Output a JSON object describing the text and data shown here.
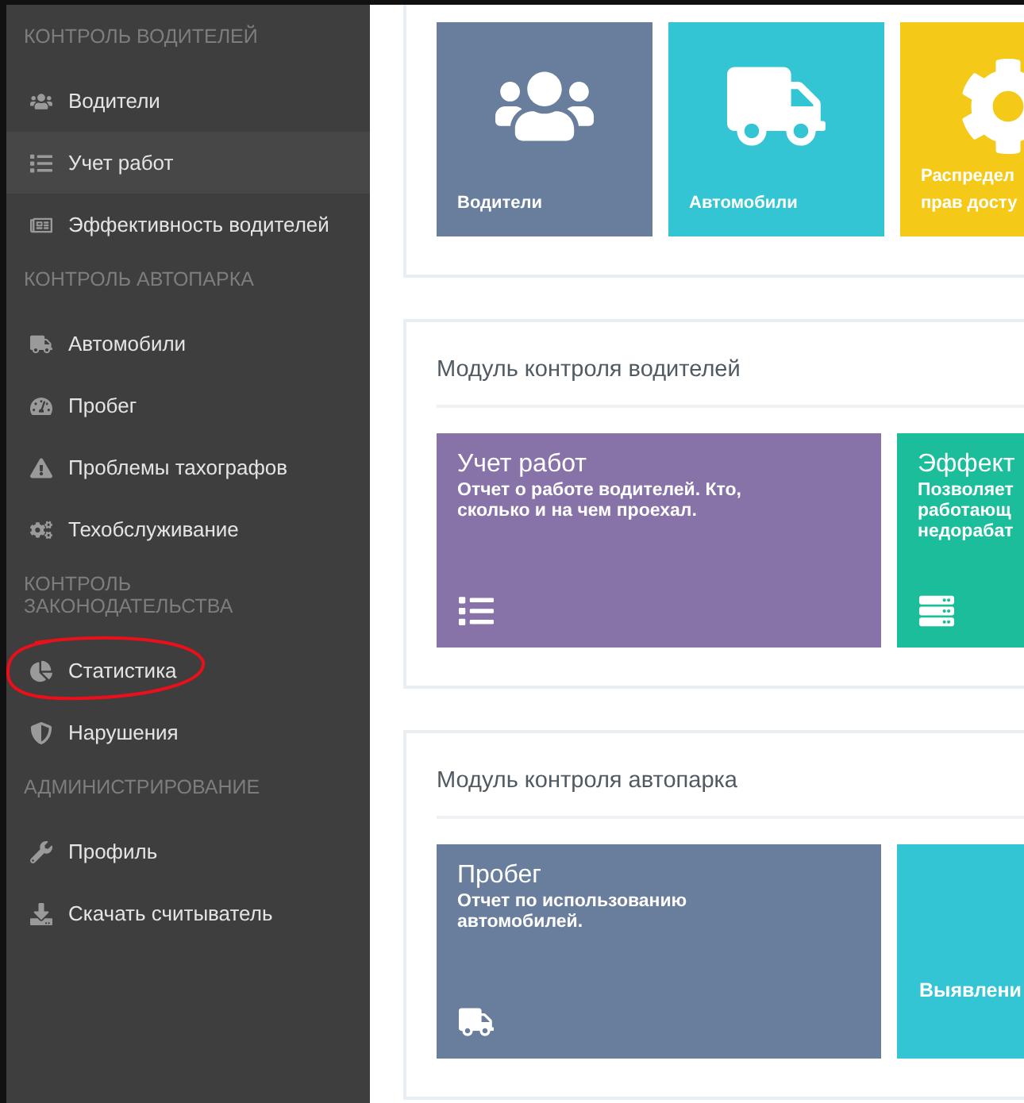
{
  "sidebar": {
    "entries": [
      {
        "kind": "header",
        "label": "КОНТРОЛЬ ВОДИТЕЛЕЙ"
      },
      {
        "kind": "item",
        "label": "Водители",
        "selected": false,
        "circled": false
      },
      {
        "kind": "item",
        "label": "Учет работ",
        "selected": true,
        "circled": false
      },
      {
        "kind": "item",
        "label": "Эффективность водителей",
        "selected": false,
        "circled": false
      },
      {
        "kind": "header",
        "label": "КОНТРОЛЬ АВТОПАРКА"
      },
      {
        "kind": "item",
        "label": "Автомобили",
        "selected": false,
        "circled": false
      },
      {
        "kind": "item",
        "label": "Пробег",
        "selected": false,
        "circled": false
      },
      {
        "kind": "item",
        "label": "Проблемы тахографов",
        "selected": false,
        "circled": false
      },
      {
        "kind": "item",
        "label": "Техобслуживание",
        "selected": false,
        "circled": false
      },
      {
        "kind": "header",
        "label": "КОНТРОЛЬ ЗАКОНОДАТЕЛЬСТВА"
      },
      {
        "kind": "item",
        "label": "Статистика",
        "selected": false,
        "circled": true
      },
      {
        "kind": "item",
        "label": "Нарушения",
        "selected": false,
        "circled": false
      },
      {
        "kind": "header",
        "label": "АДМИНИСТРИРОВАНИЕ"
      },
      {
        "kind": "item",
        "label": "Профиль",
        "selected": false,
        "circled": false
      },
      {
        "kind": "item",
        "label": "Скачать считыватель",
        "selected": false,
        "circled": false
      }
    ]
  },
  "panels": [
    {
      "tiles": [
        {
          "kind": "icon",
          "label": "Водители",
          "color": "#687e9c"
        },
        {
          "kind": "icon",
          "label": "Автомобили",
          "color": "#33c5d3"
        },
        {
          "kind": "icon",
          "label": "Распредел\nправ досту",
          "color": "#f5c918"
        }
      ]
    },
    {
      "title": "Модуль контроля водителей",
      "tiles": [
        {
          "kind": "report",
          "label": "Учет работ",
          "description": "Отчет о работе водителей. Кто, сколько и на чем проехал.",
          "color": "#8773a8"
        },
        {
          "kind": "report",
          "label": "Эффект",
          "description": "Позволяет\nработающ\nнедорабат",
          "color": "#1bbd9b"
        }
      ]
    },
    {
      "title": "Модуль контроля автопарка",
      "tiles": [
        {
          "kind": "report",
          "label": "Пробег",
          "description": "Отчет по использованию автомобилей.",
          "color": "#687e9c"
        },
        {
          "kind": "caption",
          "label": "Выявлени",
          "color": "#33c5d3"
        }
      ]
    }
  ]
}
